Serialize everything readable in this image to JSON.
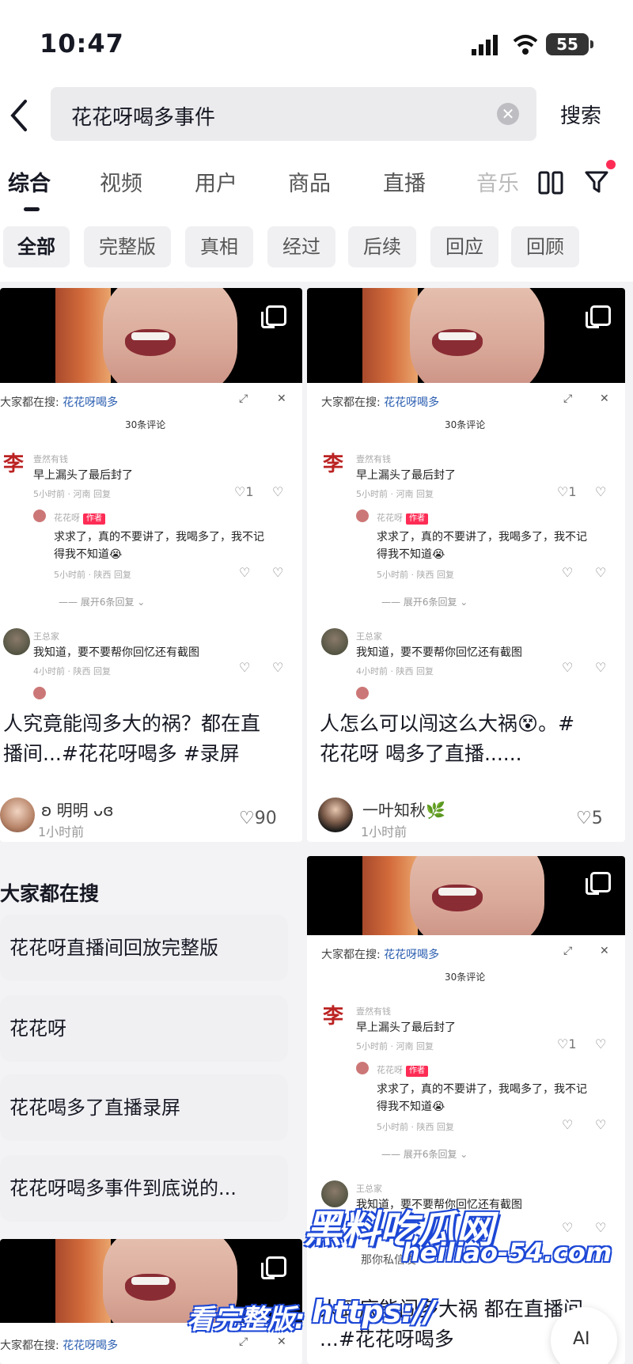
{
  "status": {
    "time": "10:47",
    "battery": "55"
  },
  "search": {
    "query": "花花呀喝多事件",
    "button": "搜索"
  },
  "tabs": [
    {
      "label": "综合"
    },
    {
      "label": "视频"
    },
    {
      "label": "用户"
    },
    {
      "label": "商品"
    },
    {
      "label": "直播"
    },
    {
      "label": "音乐"
    }
  ],
  "chips": [
    {
      "label": "全部"
    },
    {
      "label": "完整版"
    },
    {
      "label": "真相"
    },
    {
      "label": "经过"
    },
    {
      "label": "后续"
    },
    {
      "label": "回应"
    },
    {
      "label": "回顾"
    }
  ],
  "comment_panel": {
    "everyone_search": "大家都在搜:",
    "search_term": "花花呀喝多",
    "comment_count": "30条评论",
    "c1_name": "壹然有钱",
    "c1_text": "早上漏头了最后封了",
    "c1_meta": "5小时前 · 河南    回复",
    "c1_likes": "1",
    "c2_name": "花花呀",
    "c2_badge": "作者",
    "c2_text_line1": "求求了，真的不要讲了，我喝多了，我不记",
    "c2_text_line2": "得我不知道😭",
    "c2_meta": "5小时前 · 陕西    回复",
    "expand": "展开6条回复",
    "c3_name": "王总家",
    "c3_text": "我知道，要不要帮你回忆还有截图",
    "c3_meta": "4小时前 · 陕西    回复",
    "private_msg": "那你私信发"
  },
  "cards": [
    {
      "title_line1": "人究竟能闯多大的祸？都在直",
      "title_line2": "播间...#花花呀喝多 #录屏",
      "author": "明明",
      "time": "1小时前",
      "likes": "90"
    },
    {
      "title_line1": "人怎么可以闯这么大祸😵。#",
      "title_line2": "花花呀 喝多了直播......",
      "author": "一叶知秋🌿",
      "time": "1小时前",
      "likes": "5"
    },
    {
      "title_line1": "人到底能闯多大祸 都在直播间",
      "title_line2": "...#花花呀喝多"
    }
  ],
  "also_search": {
    "title": "大家都在搜",
    "items": [
      "花花呀直播间回放完整版",
      "花花呀",
      "花花喝多了直播录屏",
      "花花呀喝多事件到底说的..."
    ]
  },
  "watermark": {
    "title": "黑料吃瓜网",
    "url": "heiliao-54.com",
    "prefix": "看完整版:",
    "https": "https://"
  },
  "ai_button": "AI"
}
